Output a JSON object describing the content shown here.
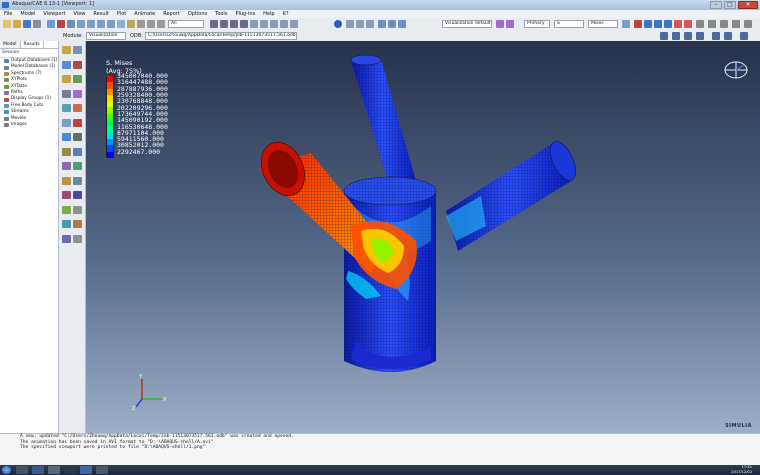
{
  "window": {
    "title": "Abaqus/CAE 6.13-1 [Viewport: 1]"
  },
  "menu": [
    "File",
    "Model",
    "Viewport",
    "View",
    "Result",
    "Plot",
    "Animate",
    "Report",
    "Options",
    "Tools",
    "Plug-ins",
    "Help",
    "K?"
  ],
  "toolbar": {
    "step_field": "All",
    "visualization_defaults": "Visualization defaults",
    "primary": "Primary",
    "s_field": "S",
    "mises_field": "Mises"
  },
  "context_bar": {
    "module_label": "Module:",
    "module_value": "Visualization",
    "odb_label": "ODB:",
    "odb_path": "C:/Users/Zhouwq/AppData/Local/Temp/Job-11513073517.561.odb"
  },
  "left_panel": {
    "tabs": [
      "Model",
      "Results"
    ],
    "session_label": "Session",
    "tree": [
      {
        "label": "Output Databases (1)",
        "color": "#5a7fbf"
      },
      {
        "label": "Model Databases (1)",
        "color": "#5a7fbf"
      },
      {
        "label": "Spectrums (7)",
        "color": "#b58a3a"
      },
      {
        "label": "XYPlots",
        "color": "#6a9a4a"
      },
      {
        "label": "XYData",
        "color": "#6a9a4a"
      },
      {
        "label": "Paths",
        "color": "#8a6ab0"
      },
      {
        "label": "Display Groups (1)",
        "color": "#c04a4a"
      },
      {
        "label": "Free Body Cuts",
        "color": "#5a9ab0"
      },
      {
        "label": "Streams",
        "color": "#4a8ad0"
      },
      {
        "label": "Movies",
        "color": "#7a7a7a"
      },
      {
        "label": "Images",
        "color": "#7a7a7a"
      }
    ]
  },
  "legend": {
    "title_lines": [
      "S, Mises",
      "(Avg: 75%)"
    ],
    "entries": [
      {
        "value": "345007040.000",
        "color": "#ff0000"
      },
      {
        "value": "316447488.000",
        "color": "#ff4a00"
      },
      {
        "value": "287887936.000",
        "color": "#ff9300"
      },
      {
        "value": "259328400.000",
        "color": "#ffdc00"
      },
      {
        "value": "230768848.000",
        "color": "#daff00"
      },
      {
        "value": "202209296.000",
        "color": "#91ff00"
      },
      {
        "value": "173649744.000",
        "color": "#48ff00"
      },
      {
        "value": "145090192.000",
        "color": "#00ff48"
      },
      {
        "value": "116530648.000",
        "color": "#00ff91"
      },
      {
        "value": "87971104.000",
        "color": "#00dcff"
      },
      {
        "value": "59411560.000",
        "color": "#0093ff"
      },
      {
        "value": "30852012.000",
        "color": "#004aff"
      },
      {
        "value": "2292467.000",
        "color": "#0000ff"
      }
    ]
  },
  "simulia_logo": "SIMULIA",
  "messages": [
    "A new, updated \"C:/Users/Zhouwq/AppData/Local/Temp/Job-11513073517.561.odb\" was created and opened.",
    "The animation has been saved in AVI format to \"D:-\\ABAQUS-shell/A.avi\"",
    "The specified viewport were printed to file \"D:\\ABAQUS-shell/1.png\""
  ],
  "tray": {
    "time": "17:41",
    "date": "2017/12/02"
  }
}
